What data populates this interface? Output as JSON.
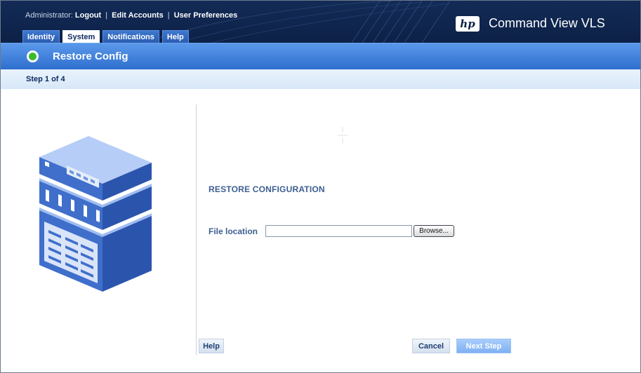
{
  "header": {
    "admin_label": "Administrator:",
    "links": [
      "Logout",
      "Edit Accounts",
      "User Preferences"
    ],
    "separator": "|",
    "logo_text": "hp",
    "product_name": "Command View VLS"
  },
  "tabs": [
    {
      "label": "Identity",
      "active": false
    },
    {
      "label": "System",
      "active": true
    },
    {
      "label": "Notifications",
      "active": false
    },
    {
      "label": "Help",
      "active": false
    }
  ],
  "page": {
    "title": "Restore Config",
    "step": "Step 1 of 4",
    "heading": "RESTORE CONFIGURATION"
  },
  "form": {
    "file_location_label": "File location",
    "file_location_value": "",
    "browse_label": "Browse..."
  },
  "buttons": {
    "help": "Help",
    "cancel": "Cancel",
    "next": "Next Step"
  },
  "colors": {
    "header_bg": "#0d2147",
    "title_bar": "#3b7bd8",
    "step_bar": "#dfeefb",
    "server_illustration": "#3f6fcb",
    "next_button": "#8dbaf5"
  },
  "icons": [
    "success-check-icon",
    "hp-logo",
    "server-illustration"
  ]
}
